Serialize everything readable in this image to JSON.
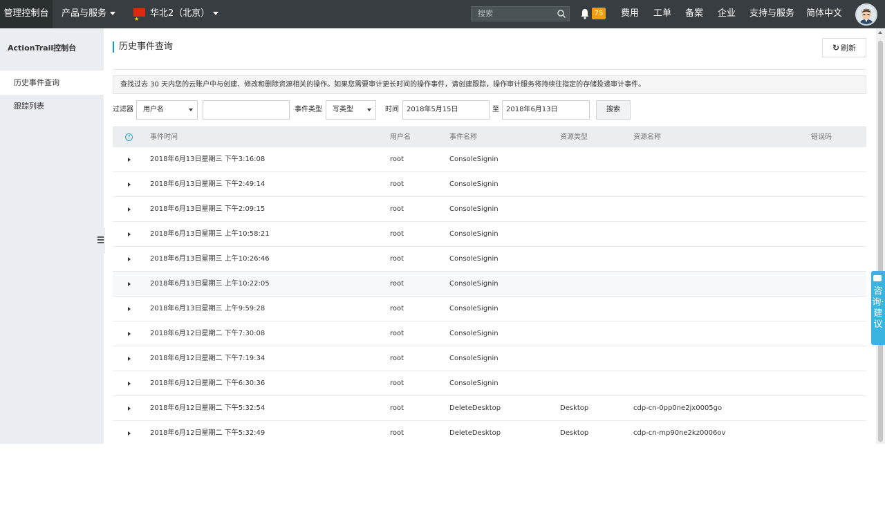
{
  "topbar": {
    "brand": "管理控制台",
    "products": "产品与服务",
    "region": "华北2（北京）",
    "search_placeholder": "搜索",
    "notification_count": "75",
    "nav": [
      "费用",
      "工单",
      "备案",
      "企业",
      "支持与服务",
      "简体中文"
    ]
  },
  "sidebar": {
    "title": "ActionTrail控制台",
    "items": [
      {
        "label": "历史事件查询",
        "active": true
      },
      {
        "label": "跟踪列表",
        "active": false
      }
    ]
  },
  "main": {
    "title": "历史事件查询",
    "refresh_label": "刷新",
    "notice": "查找过去 30 天内您的云账户中与创建、修改和删除资源相关的操作。如果您需要审计更长时间的操作事件，请创建跟踪，操作审计服务将持续往指定的存储投递审计事件。",
    "filters": {
      "filter_label": "过滤器",
      "filter_field": "用户名",
      "filter_value": "",
      "event_type_label": "事件类型",
      "event_type": "写类型",
      "time_label": "时间",
      "start_date": "2018年5月15日",
      "to_label": "至",
      "end_date": "2018年6月13日",
      "search_label": "搜索"
    },
    "table": {
      "columns": [
        "事件时间",
        "用户名",
        "事件名称",
        "资源类型",
        "资源名称",
        "错误码"
      ],
      "rows": [
        {
          "time": "2018年6月13日星期三 下午3:16:08",
          "user": "root",
          "event": "ConsoleSignin",
          "rtype": "",
          "rname": "",
          "err": ""
        },
        {
          "time": "2018年6月13日星期三 下午2:49:14",
          "user": "root",
          "event": "ConsoleSignin",
          "rtype": "",
          "rname": "",
          "err": ""
        },
        {
          "time": "2018年6月13日星期三 下午2:09:15",
          "user": "root",
          "event": "ConsoleSignin",
          "rtype": "",
          "rname": "",
          "err": ""
        },
        {
          "time": "2018年6月13日星期三 上午10:58:21",
          "user": "root",
          "event": "ConsoleSignin",
          "rtype": "",
          "rname": "",
          "err": ""
        },
        {
          "time": "2018年6月13日星期三 上午10:26:46",
          "user": "root",
          "event": "ConsoleSignin",
          "rtype": "",
          "rname": "",
          "err": ""
        },
        {
          "time": "2018年6月13日星期三 上午10:22:05",
          "user": "root",
          "event": "ConsoleSignin",
          "rtype": "",
          "rname": "",
          "err": ""
        },
        {
          "time": "2018年6月13日星期三 上午9:59:28",
          "user": "root",
          "event": "ConsoleSignin",
          "rtype": "",
          "rname": "",
          "err": ""
        },
        {
          "time": "2018年6月12日星期二 下午7:30:08",
          "user": "root",
          "event": "ConsoleSignin",
          "rtype": "",
          "rname": "",
          "err": ""
        },
        {
          "time": "2018年6月12日星期二 下午7:19:34",
          "user": "root",
          "event": "ConsoleSignin",
          "rtype": "",
          "rname": "",
          "err": ""
        },
        {
          "time": "2018年6月12日星期二 下午6:30:36",
          "user": "root",
          "event": "ConsoleSignin",
          "rtype": "",
          "rname": "",
          "err": ""
        },
        {
          "time": "2018年6月12日星期二 下午5:32:54",
          "user": "root",
          "event": "DeleteDesktop",
          "rtype": "Desktop",
          "rname": "cdp-cn-0pp0ne2jx0005go",
          "err": ""
        },
        {
          "time": "2018年6月12日星期二 下午5:32:49",
          "user": "root",
          "event": "DeleteDesktop",
          "rtype": "Desktop",
          "rname": "cdp-cn-mp90ne2kz0006ov",
          "err": ""
        }
      ]
    }
  },
  "consult_tab": "咨询·建议",
  "colors": {
    "topbar_bg": "#373d41",
    "sidebar_bg": "#eaedf1",
    "accent": "#00a2ca",
    "badge": "#f39c12",
    "consult": "#39b3e0"
  }
}
